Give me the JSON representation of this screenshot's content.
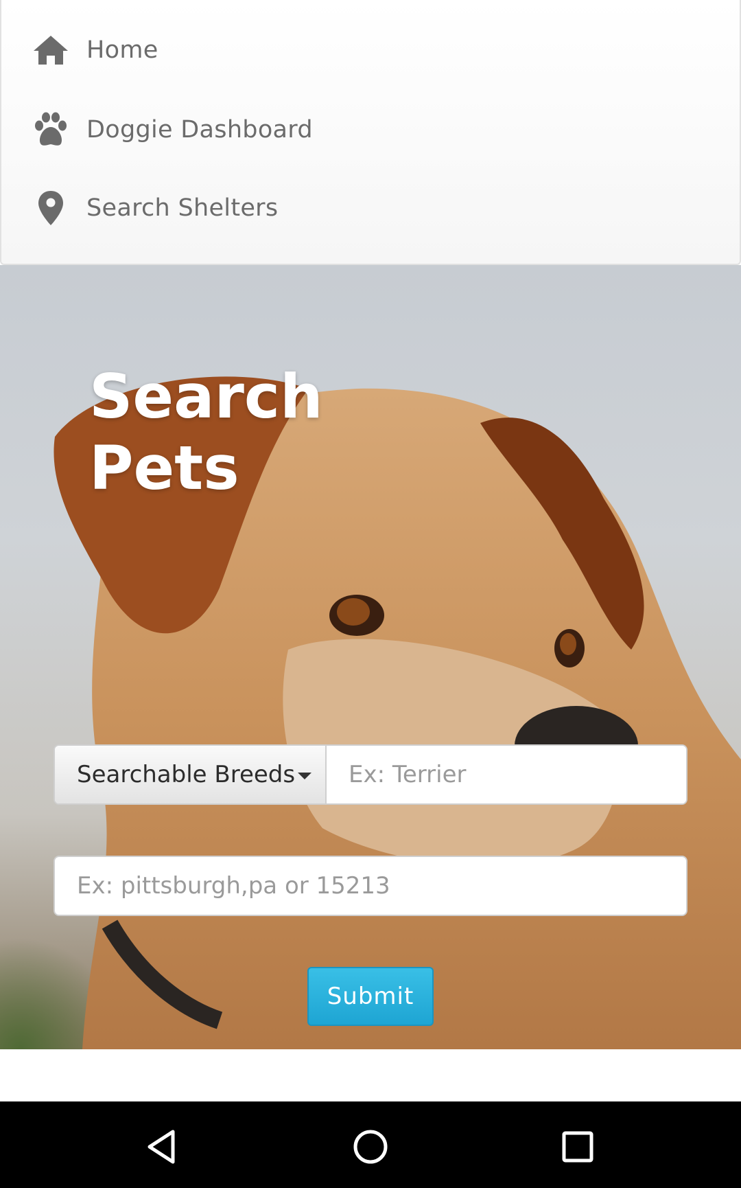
{
  "nav": {
    "items": [
      {
        "label": "Home",
        "icon": "home-icon"
      },
      {
        "label": "Doggie Dashboard",
        "icon": "paw-icon"
      },
      {
        "label": "Search Shelters",
        "icon": "map-pin-icon"
      }
    ]
  },
  "hero": {
    "title_line1": "Search",
    "title_line2": "Pets"
  },
  "form": {
    "breed_dropdown_label": "Searchable Breeds",
    "breed_placeholder": "Ex: Terrier",
    "location_placeholder": "Ex: pittsburgh,pa or 15213",
    "submit_label": "Submit"
  },
  "colors": {
    "nav_text": "#6b6b6b",
    "submit_bg": "#29b3de",
    "hero_text": "#ffffff"
  }
}
